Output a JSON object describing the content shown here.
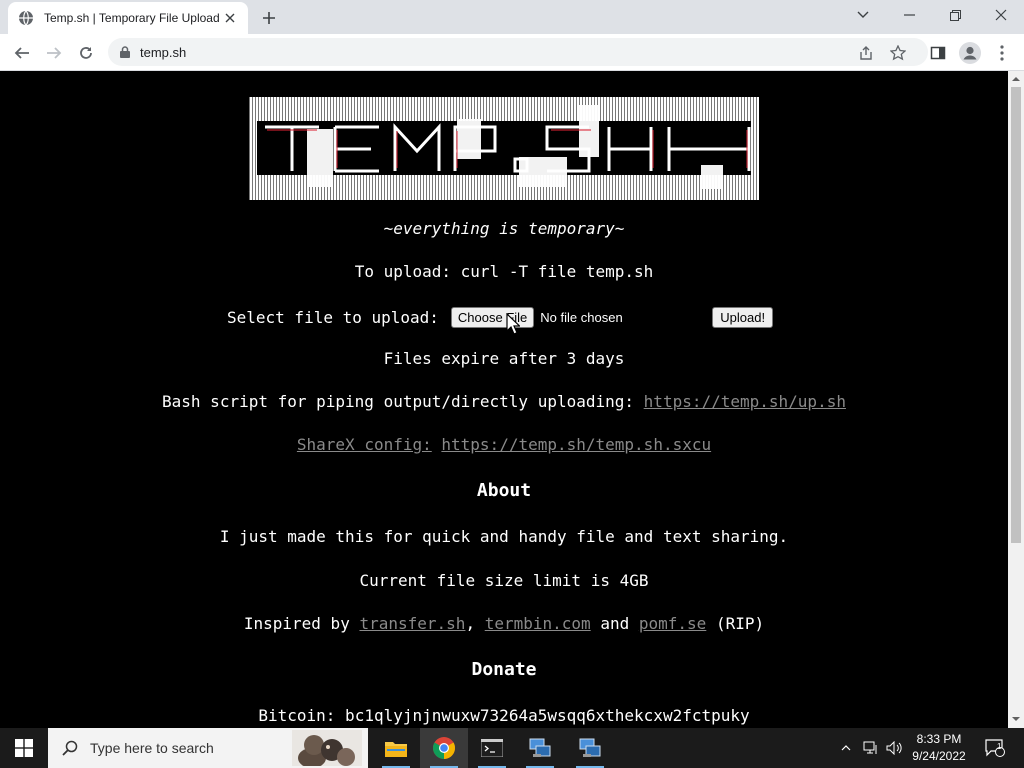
{
  "browser": {
    "tab_title": "Temp.sh | Temporary File Upload",
    "url": "temp.sh"
  },
  "page": {
    "tagline": "~everything is temporary~",
    "upload_instruction": "To upload: curl -T file temp.sh",
    "select_label": "Select file to upload:",
    "choose_file_label": "Choose File",
    "no_file_text": "No file chosen",
    "upload_button": "Upload!",
    "expire_text": "Files expire after 3 days",
    "bash_text": "Bash script for piping output/directly uploading:",
    "bash_link": "https://temp.sh/up.sh",
    "sharex_label": "ShareX config:",
    "sharex_link": "https://temp.sh/temp.sh.sxcu",
    "about_heading": "About",
    "about_text": "I just made this for quick and handy file and text sharing.",
    "limit_text": "Current file size limit is 4GB",
    "inspired": {
      "prefix": "Inspired by",
      "link1": "transfer.sh",
      "comma": ",",
      "link2": "termbin.com",
      "and": "and",
      "link3": "pomf.se",
      "suffix": "(RIP)"
    },
    "donate_heading": "Donate",
    "bitcoin_text": "Bitcoin: bc1qlyjnjnwuxw73264a5wsqq6xthekcxw2fctpuky"
  },
  "taskbar": {
    "search_placeholder": "Type here to search",
    "time": "8:33 PM",
    "date": "9/24/2022",
    "notification_count": "1"
  },
  "icons": {
    "tab_favicon": "globe-icon",
    "tab_close": "close-icon",
    "new_tab": "plus-icon",
    "back": "back-arrow-icon",
    "forward": "forward-arrow-icon",
    "reload": "reload-icon",
    "lock": "lock-icon",
    "share": "share-icon",
    "bookmark": "star-icon",
    "sidepanel": "side-panel-icon",
    "profile": "profile-icon",
    "menu": "kebab-menu-icon"
  },
  "colors": {
    "page_bg": "#000000",
    "page_text": "#ffffff",
    "link": "#8a8a8a",
    "tabstrip": "#dee1e6",
    "taskbar": "#1b1b1b"
  }
}
